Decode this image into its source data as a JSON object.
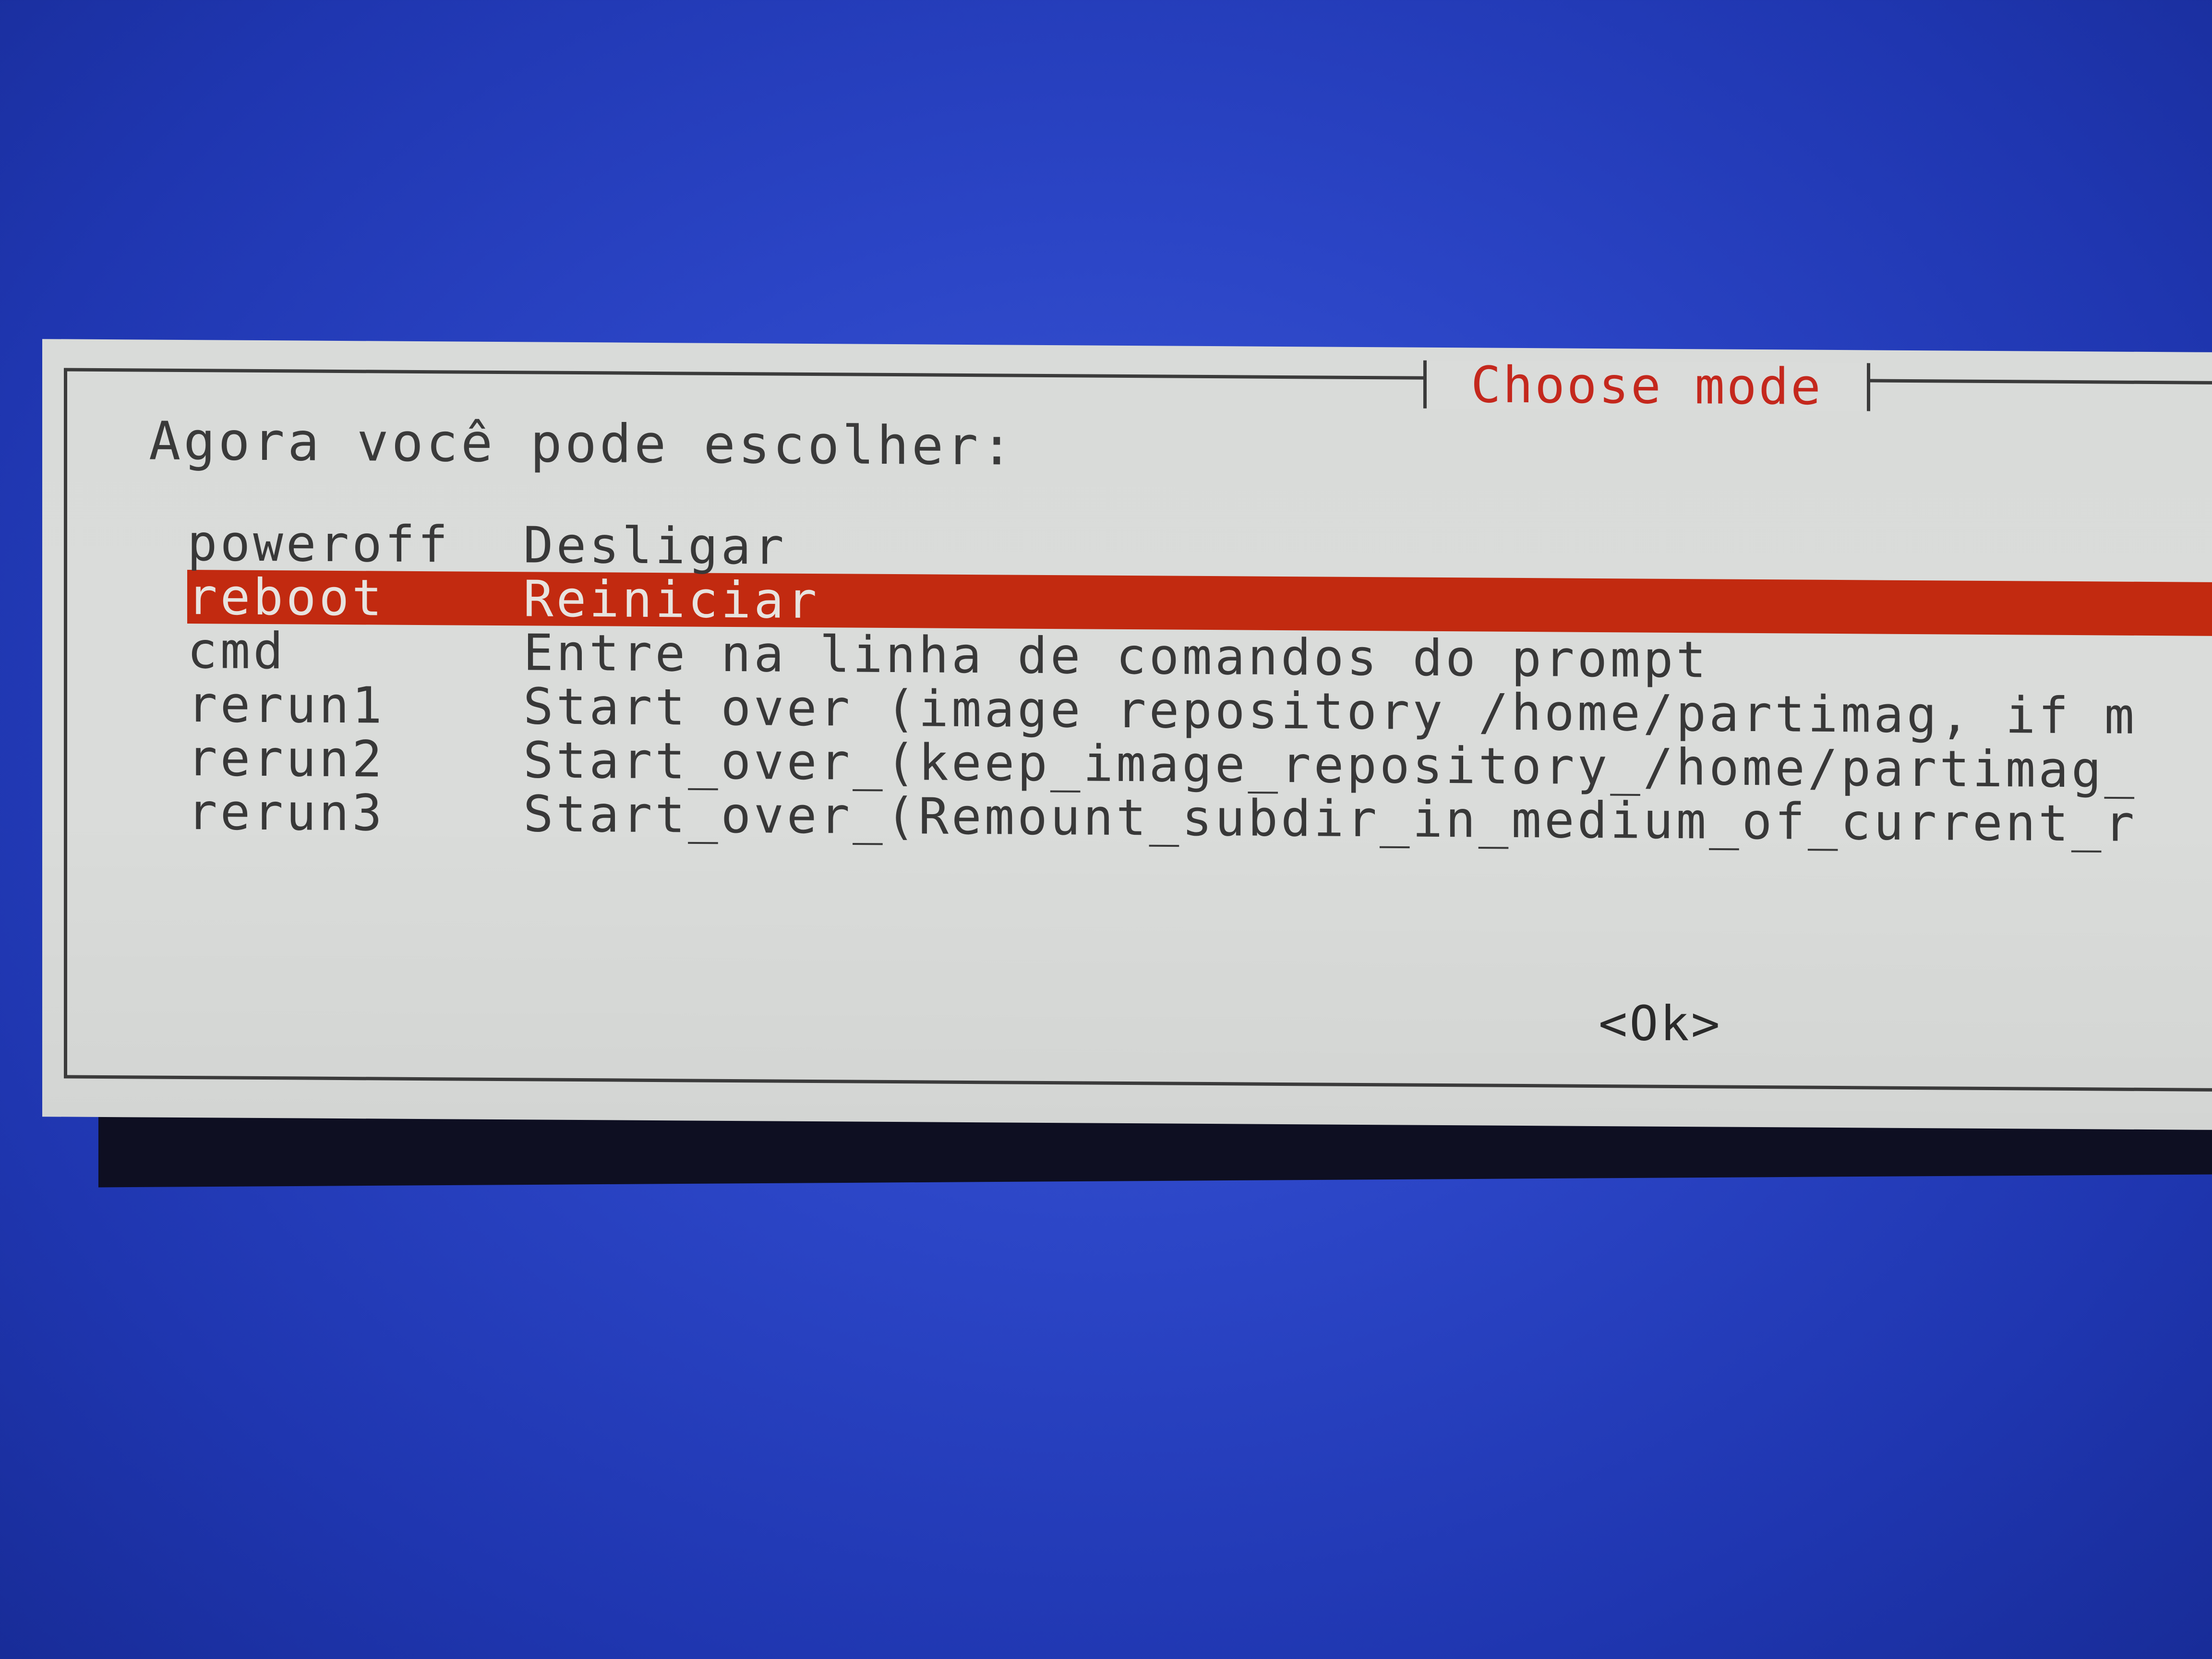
{
  "dialog": {
    "title": "Choose mode",
    "prompt": "Agora você pode escolher:",
    "ok_label": "<Ok>"
  },
  "menu": {
    "items": [
      {
        "tag": "poweroff",
        "description": "Desligar",
        "selected": false
      },
      {
        "tag": "reboot",
        "description": "Reiniciar",
        "selected": true
      },
      {
        "tag": "cmd",
        "description": "Entre na linha de comandos do prompt",
        "selected": false
      },
      {
        "tag": "rerun1",
        "description": "Start over (image repository /home/partimag, if m",
        "selected": false
      },
      {
        "tag": "rerun2",
        "description": "Start_over_(keep_image_repository_/home/partimag_",
        "selected": false
      },
      {
        "tag": "rerun3",
        "description": "Start_over_(Remount_subdir_in_medium_of_current_r",
        "selected": false
      }
    ]
  },
  "colors": {
    "background": "#2b45c6",
    "dialog": "#dadcda",
    "highlight": "#c22a10",
    "title": "#c4281d"
  }
}
